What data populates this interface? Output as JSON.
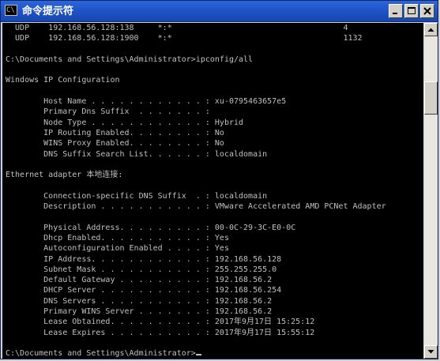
{
  "window": {
    "title": "命令提示符",
    "icon": "console-icon",
    "icon_glyph": "C\\",
    "controls": [
      "minimize-icon",
      "maximize-icon",
      "close-icon"
    ]
  },
  "console": {
    "lines": [
      "  UDP    192.168.56.128:138     *:*                                    4",
      "  UDP    192.168.56.128:1900    *:*                                    1132",
      "",
      "C:\\Documents and Settings\\Administrator>ipconfig/all",
      "",
      "Windows IP Configuration",
      "",
      "        Host Name . . . . . . . . . . . . : xu-0795463657e5",
      "        Primary Dns Suffix  . . . . . . . :",
      "        Node Type . . . . . . . . . . . . : Hybrid",
      "        IP Routing Enabled. . . . . . . . : No",
      "        WINS Proxy Enabled. . . . . . . . : No",
      "        DNS Suffix Search List. . . . . . : localdomain",
      "",
      "Ethernet adapter 本地连接:",
      "",
      "        Connection-specific DNS Suffix  . : localdomain",
      "        Description . . . . . . . . . . . : VMware Accelerated AMD PCNet Adapter",
      "",
      "        Physical Address. . . . . . . . . : 00-0C-29-3C-E0-0C",
      "        Dhcp Enabled. . . . . . . . . . . : Yes",
      "        Autoconfiguration Enabled . . . . : Yes",
      "        IP Address. . . . . . . . . . . . : 192.168.56.128",
      "        Subnet Mask . . . . . . . . . . . : 255.255.255.0",
      "        Default Gateway . . . . . . . . . : 192.168.56.2",
      "        DHCP Server . . . . . . . . . . . : 192.168.56.254",
      "        DNS Servers . . . . . . . . . . . : 192.168.56.2",
      "        Primary WINS Server . . . . . . . : 192.168.56.2",
      "        Lease Obtained. . . . . . . . . . : 2017年9月17日 15:25:12",
      "        Lease Expires . . . . . . . . . . : 2017年9月17日 15:55:12",
      "",
      "C:\\Documents and Settings\\Administrator>"
    ]
  },
  "scrollbar": {
    "up_icon": "scroll-up-arrow-icon",
    "down_icon": "scroll-down-arrow-icon"
  },
  "colors": {
    "titlebar": "#1f55c8",
    "console_bg": "#000000",
    "console_text": "#c0c0c0"
  }
}
